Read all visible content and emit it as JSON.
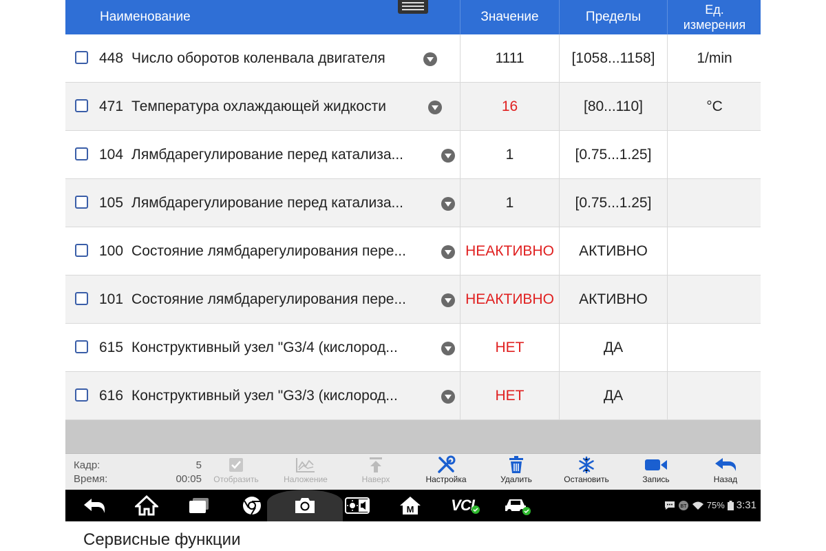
{
  "header": {
    "name": "Наименование",
    "value": "Значение",
    "limits": "Пределы",
    "units_line1": "Ед.",
    "units_line2": "измерения"
  },
  "rows": [
    {
      "id": "448",
      "name": "Число оборотов коленвала двигателя",
      "value": "1111",
      "limits": "[1058...1158]",
      "unit": "1/min",
      "value_color": "#222222"
    },
    {
      "id": "471",
      "name": "Температура охлаждающей жидкости",
      "value": "16",
      "limits": "[80...110]",
      "unit": "°C",
      "value_color": "#e02020"
    },
    {
      "id": "104",
      "name": "Лямбдарегулирование перед катализа...",
      "value": "1",
      "limits": "[0.75...1.25]",
      "unit": "",
      "value_color": "#222222"
    },
    {
      "id": "105",
      "name": "Лямбдарегулирование перед катализа...",
      "value": "1",
      "limits": "[0.75...1.25]",
      "unit": "",
      "value_color": "#222222"
    },
    {
      "id": "100",
      "name": "Состояние лямбдарегулирования пере...",
      "value": "НЕАКТИВНО",
      "limits": "АКТИВНО",
      "unit": "",
      "value_color": "#e02020"
    },
    {
      "id": "101",
      "name": "Состояние лямбдарегулирования пере...",
      "value": "НЕАКТИВНО",
      "limits": "АКТИВНО",
      "unit": "",
      "value_color": "#e02020"
    },
    {
      "id": "615",
      "name": "Конструктивный узел \"G3/4 (кислород...",
      "value": "НЕТ",
      "limits": "ДА",
      "unit": "",
      "value_color": "#e02020"
    },
    {
      "id": "616",
      "name": "Конструктивный узел \"G3/3 (кислород...",
      "value": "НЕТ",
      "limits": "ДА",
      "unit": "",
      "value_color": "#e02020"
    }
  ],
  "toolbar": {
    "frame_label": "Кадр:",
    "frame_value": "5",
    "time_label": "Время:",
    "time_value": "00:05",
    "buttons": {
      "display": "Отобразить",
      "overlay": "Наложение",
      "top": "Наверх",
      "settings": "Настройка",
      "delete": "Удалить",
      "freeze": "Остановить",
      "record": "Запись",
      "back": "Назад"
    }
  },
  "navbar": {
    "vci_label": "VCI",
    "m_label": "M",
    "battery": "75%",
    "time": "3:31",
    "bt_label": "BT"
  },
  "caption": "Сервисные функции",
  "colors": {
    "header_bg": "#2f6fd6",
    "accent_blue": "#1a5fd0",
    "alert_red": "#e02020"
  }
}
